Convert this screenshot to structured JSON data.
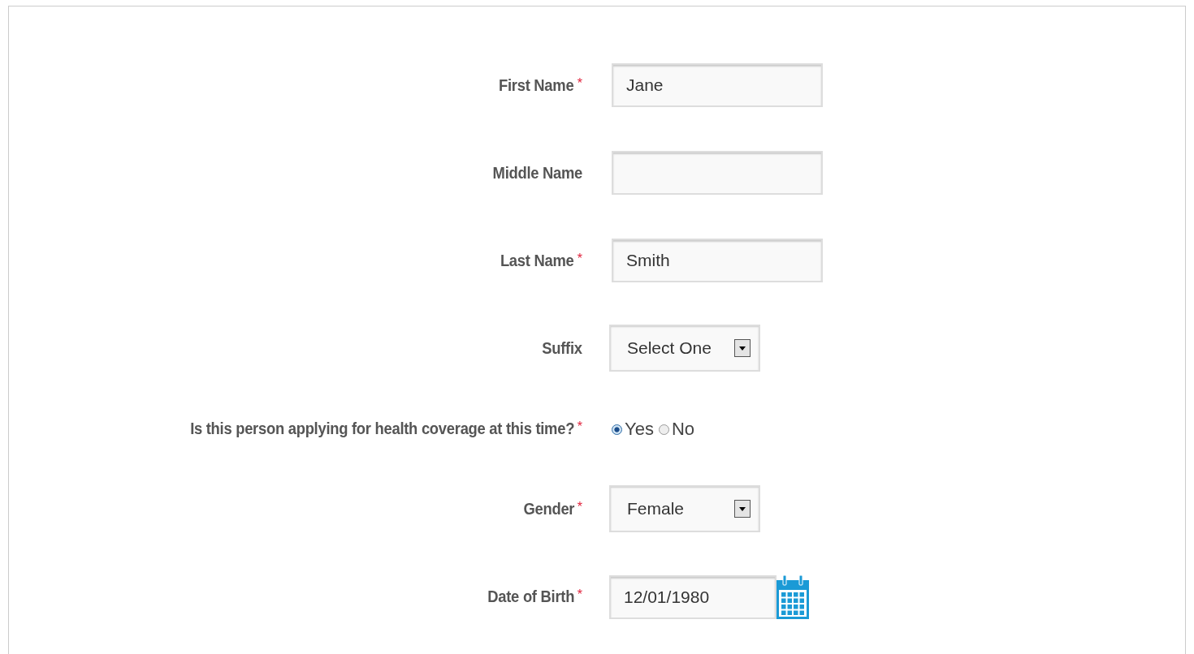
{
  "fields": [
    {
      "kind": "text",
      "label": "First Name",
      "asterisk": "*",
      "value": "Jane"
    },
    {
      "kind": "text",
      "label": "Middle Name"
    },
    {
      "kind": "text",
      "label": "Last Name",
      "asterisk": "*",
      "value": "Smith"
    },
    {
      "kind": "select",
      "label": "Suffix",
      "value": "Select One"
    },
    {
      "kind": "radio",
      "label": "Is this person applying for health coverage at this time?",
      "asterisk": "*",
      "options": [
        {
          "label": "Yes",
          "selected": true
        },
        {
          "label": "No",
          "selected": false
        }
      ]
    },
    {
      "kind": "select",
      "label": "Gender",
      "asterisk": "*",
      "value": "Female"
    },
    {
      "kind": "date",
      "label": "Date of Birth",
      "asterisk": "*",
      "value": "12/01/1980"
    }
  ]
}
